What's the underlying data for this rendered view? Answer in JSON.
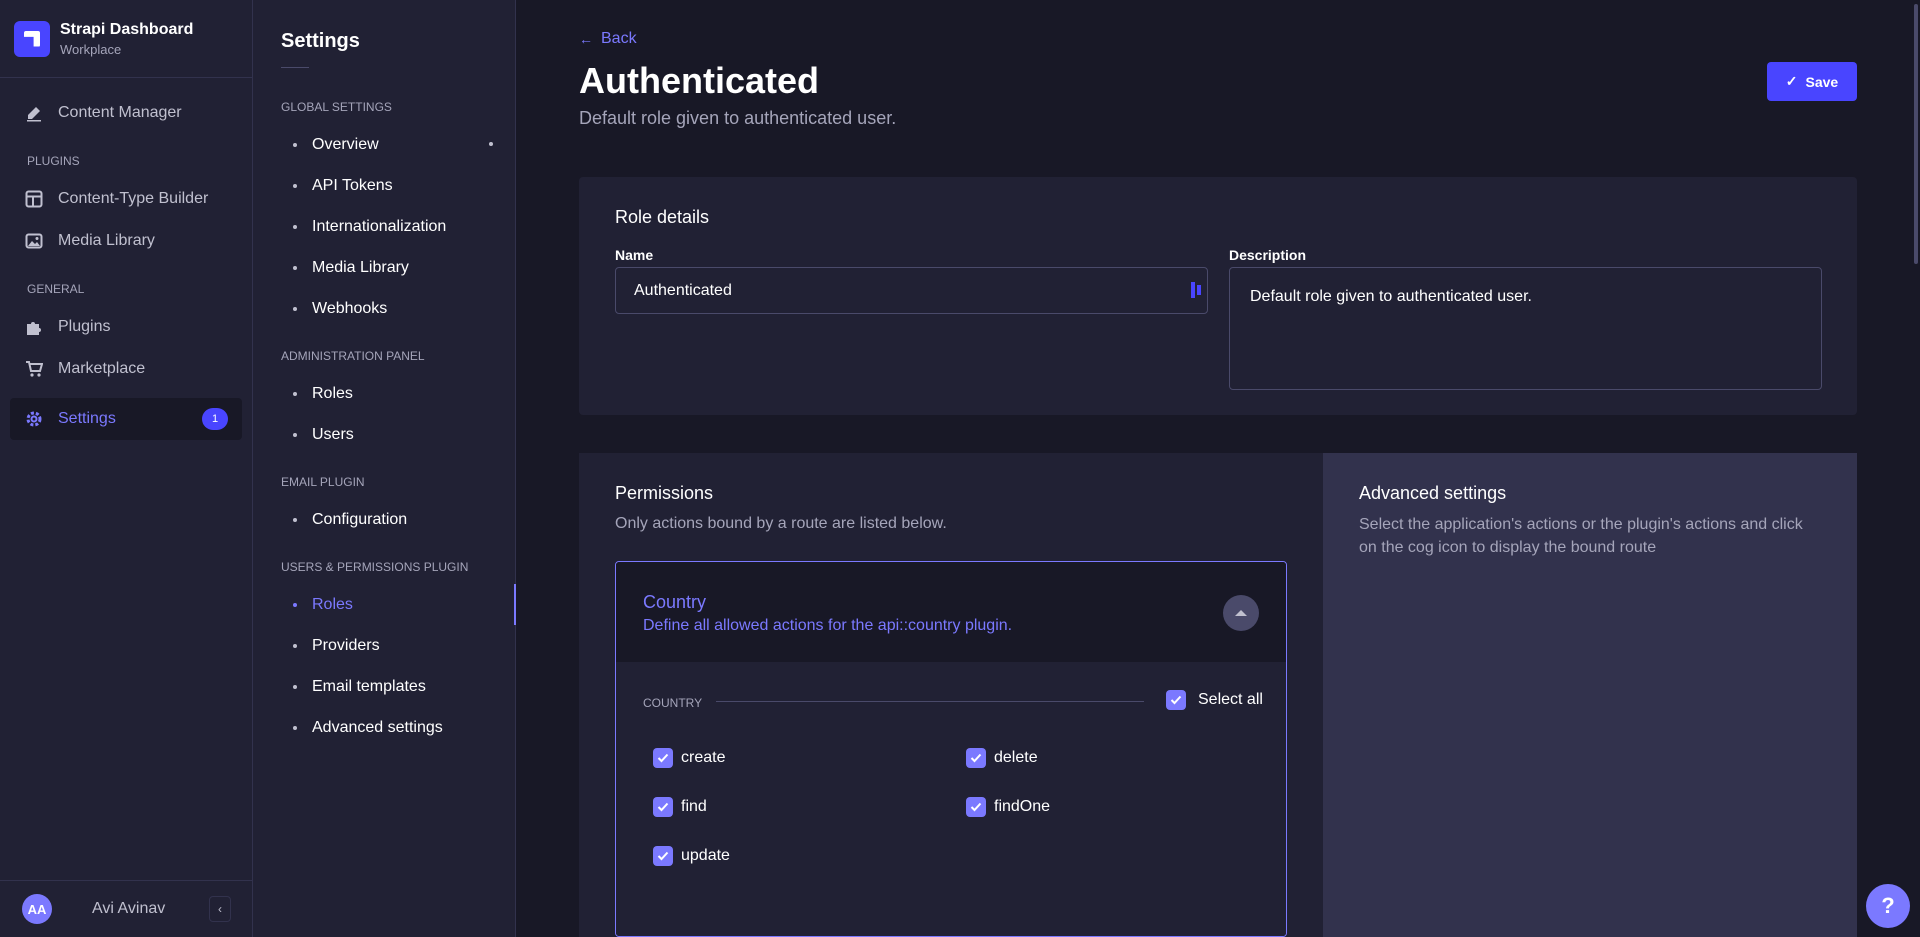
{
  "brand": {
    "title": "Strapi Dashboard",
    "subtitle": "Workplace"
  },
  "mainnav": {
    "content_manager": "Content Manager",
    "plugins_section": "PLUGINS",
    "content_type_builder": "Content-Type Builder",
    "media_library": "Media Library",
    "general_section": "GENERAL",
    "plugins": "Plugins",
    "marketplace": "Marketplace",
    "settings": "Settings",
    "settings_badge": "1"
  },
  "user": {
    "initials": "AA",
    "name": "Avi Avinav"
  },
  "subnav": {
    "title": "Settings",
    "global_section": "GLOBAL SETTINGS",
    "global_items": [
      "Overview",
      "API Tokens",
      "Internationalization",
      "Media Library",
      "Webhooks"
    ],
    "admin_section": "ADMINISTRATION PANEL",
    "admin_items": [
      "Roles",
      "Users"
    ],
    "email_section": "EMAIL PLUGIN",
    "email_items": [
      "Configuration"
    ],
    "up_section": "USERS & PERMISSIONS PLUGIN",
    "up_items": [
      "Roles",
      "Providers",
      "Email templates",
      "Advanced settings"
    ]
  },
  "header": {
    "back": "Back",
    "title": "Authenticated",
    "subtitle": "Default role given to authenticated user.",
    "save": "Save"
  },
  "role_details": {
    "title": "Role details",
    "name_label": "Name",
    "name_value": "Authenticated",
    "description_label": "Description",
    "description_value": "Default role given to authenticated user."
  },
  "permissions": {
    "title": "Permissions",
    "description": "Only actions bound by a route are listed below.",
    "accordion": {
      "title": "Country",
      "description": "Define all allowed actions for the api::country plugin.",
      "group_label": "COUNTRY",
      "select_all": "Select all",
      "actions": [
        "create",
        "delete",
        "find",
        "findOne",
        "update"
      ]
    }
  },
  "advanced": {
    "title": "Advanced settings",
    "description": "Select the application's actions or the plugin's actions and click on the cog icon to display the bound route"
  },
  "help": "?",
  "colors": {
    "primary": "#4945ff",
    "accent": "#7b79ff",
    "bg": "#181826",
    "panel": "#212134"
  }
}
